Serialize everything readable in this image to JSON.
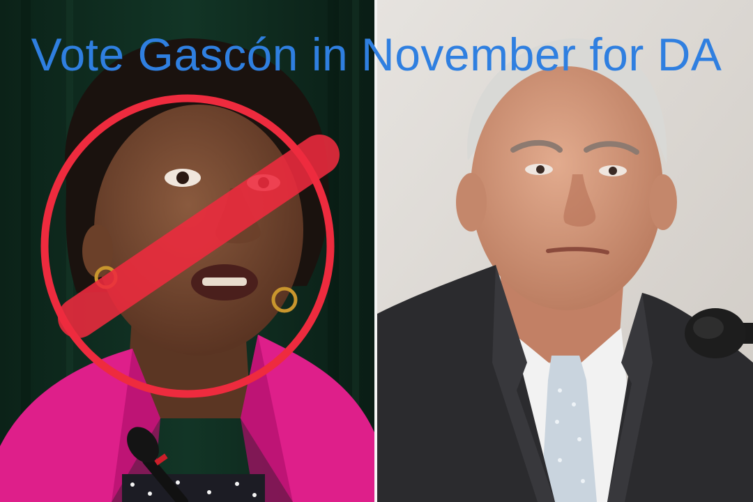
{
  "headline": {
    "text": "Vote Gascón in November for DA",
    "color": "#2f7fe0"
  },
  "left_photo": {
    "subject": "woman-in-pink-jacket-speaking",
    "background_color": "#0e2a1c",
    "jacket_color": "#e0208c",
    "prohibition_color": "#ee2b3e"
  },
  "right_photo": {
    "subject": "gray-haired-man-in-suit",
    "background_color": "#dcd8d3",
    "suit_color": "#2b2b2e",
    "tie_color": "#c9d4de"
  }
}
